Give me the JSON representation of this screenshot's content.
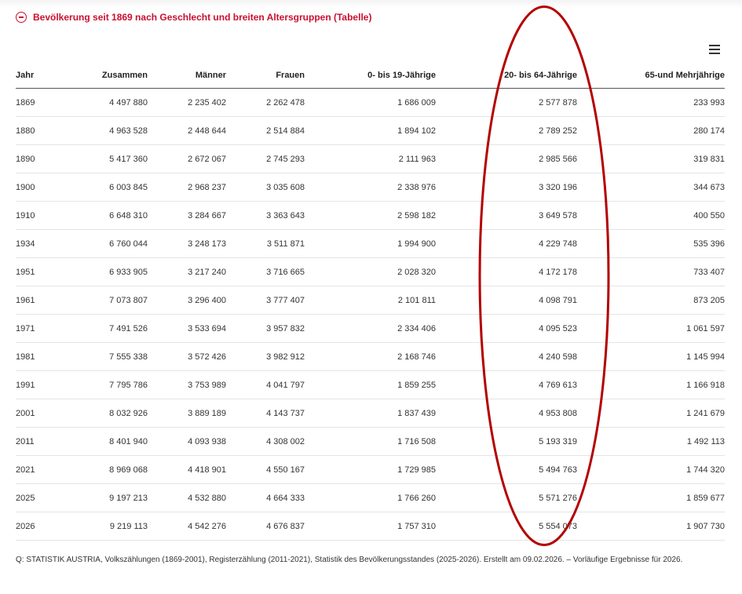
{
  "section": {
    "title": "Bevölkerung seit 1869 nach Geschlecht und breiten Altersgruppen (Tabelle)"
  },
  "icons": {
    "collapse": "minus-circle-icon",
    "menu": "hamburger-menu-icon"
  },
  "colors": {
    "accent": "#c8102e",
    "annotation": "#b30000"
  },
  "table": {
    "headers": [
      "Jahr",
      "Zusammen",
      "Männer",
      "Frauen",
      "0- bis 19-Jährige",
      "20- bis 64-Jährige",
      "65-und Mehrjährige"
    ],
    "rows": [
      [
        "1869",
        "4 497 880",
        "2 235 402",
        "2 262 478",
        "1 686 009",
        "2 577 878",
        "233 993"
      ],
      [
        "1880",
        "4 963 528",
        "2 448 644",
        "2 514 884",
        "1 894 102",
        "2 789 252",
        "280 174"
      ],
      [
        "1890",
        "5 417 360",
        "2 672 067",
        "2 745 293",
        "2 111 963",
        "2 985 566",
        "319 831"
      ],
      [
        "1900",
        "6 003 845",
        "2 968 237",
        "3 035 608",
        "2 338 976",
        "3 320 196",
        "344 673"
      ],
      [
        "1910",
        "6 648 310",
        "3 284 667",
        "3 363 643",
        "2 598 182",
        "3 649 578",
        "400 550"
      ],
      [
        "1934",
        "6 760 044",
        "3 248 173",
        "3 511 871",
        "1 994 900",
        "4 229 748",
        "535 396"
      ],
      [
        "1951",
        "6 933 905",
        "3 217 240",
        "3 716 665",
        "2 028 320",
        "4 172 178",
        "733 407"
      ],
      [
        "1961",
        "7 073 807",
        "3 296 400",
        "3 777 407",
        "2 101 811",
        "4 098 791",
        "873 205"
      ],
      [
        "1971",
        "7 491 526",
        "3 533 694",
        "3 957 832",
        "2 334 406",
        "4 095 523",
        "1 061 597"
      ],
      [
        "1981",
        "7 555 338",
        "3 572 426",
        "3 982 912",
        "2 168 746",
        "4 240 598",
        "1 145 994"
      ],
      [
        "1991",
        "7 795 786",
        "3 753 989",
        "4 041 797",
        "1 859 255",
        "4 769 613",
        "1 166 918"
      ],
      [
        "2001",
        "8 032 926",
        "3 889 189",
        "4 143 737",
        "1 837 439",
        "4 953 808",
        "1 241 679"
      ],
      [
        "2011",
        "8 401 940",
        "4 093 938",
        "4 308 002",
        "1 716 508",
        "5 193 319",
        "1 492 113"
      ],
      [
        "2021",
        "8 969 068",
        "4 418 901",
        "4 550 167",
        "1 729 985",
        "5 494 763",
        "1 744 320"
      ],
      [
        "2025",
        "9 197 213",
        "4 532 880",
        "4 664 333",
        "1 766 260",
        "5 571 276",
        "1 859 677"
      ],
      [
        "2026",
        "9 219 113",
        "4 542 276",
        "4 676 837",
        "1 757 310",
        "5 554 073",
        "1 907 730"
      ]
    ]
  },
  "source_note": "Q: STATISTIK AUSTRIA, Volkszählungen (1869-2001), Registerzählung (2011-2021), Statistik des Bevölkerungsstandes (2025-2026). Erstellt am 09.02.2026. – Vorläufige Ergebnisse für 2026."
}
